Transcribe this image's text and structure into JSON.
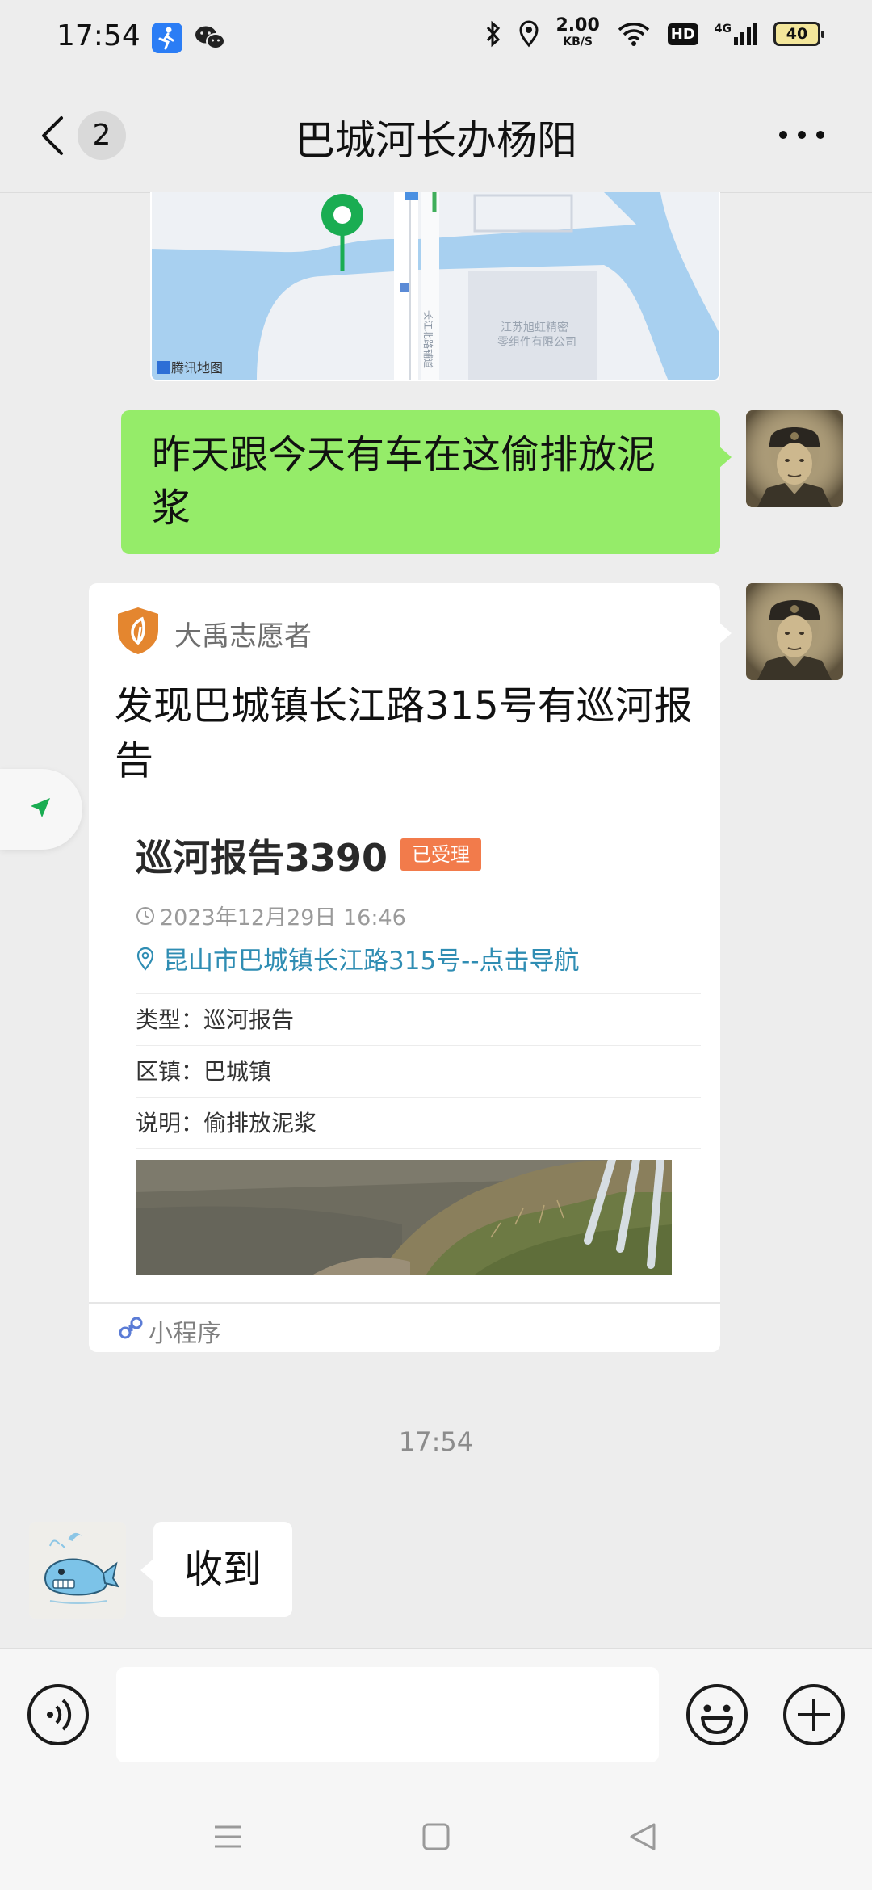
{
  "status_bar": {
    "time": "17:54",
    "net_speed_value": "2.00",
    "net_speed_unit": "KB/S",
    "hd": "HD",
    "signal": "4G",
    "battery": "40"
  },
  "header": {
    "unread_count": "2",
    "title": "巴城河长办杨阳"
  },
  "map": {
    "credit": "腾讯地图",
    "road_label": "长江北路辅道",
    "poi_label": "江苏旭虹精密零组件有限公司"
  },
  "messages": {
    "sent_text": "昨天跟今天有车在这偷排放泥浆",
    "card": {
      "source": "大禹志愿者",
      "title": "发现巴城镇长江路315号有巡河报告",
      "report_number": "巡河报告3390",
      "status": "已受理",
      "datetime": "2023年12月29日 16:46",
      "location_link": "昆山市巴城镇长江路315号--点击导航",
      "type_label": "类型：",
      "type_value": "巡河报告",
      "district_label": "区镇：",
      "district_value": "巴城镇",
      "desc_label": "说明：",
      "desc_value": "偷排放泥浆",
      "footer_label": "小程序"
    },
    "timestamp": "17:54",
    "received_text": "收到"
  },
  "colors": {
    "sent_bubble": "#95ec69",
    "status_tag": "#f27b4b",
    "link": "#2f8db3",
    "brand_shield": "#e4862f"
  }
}
